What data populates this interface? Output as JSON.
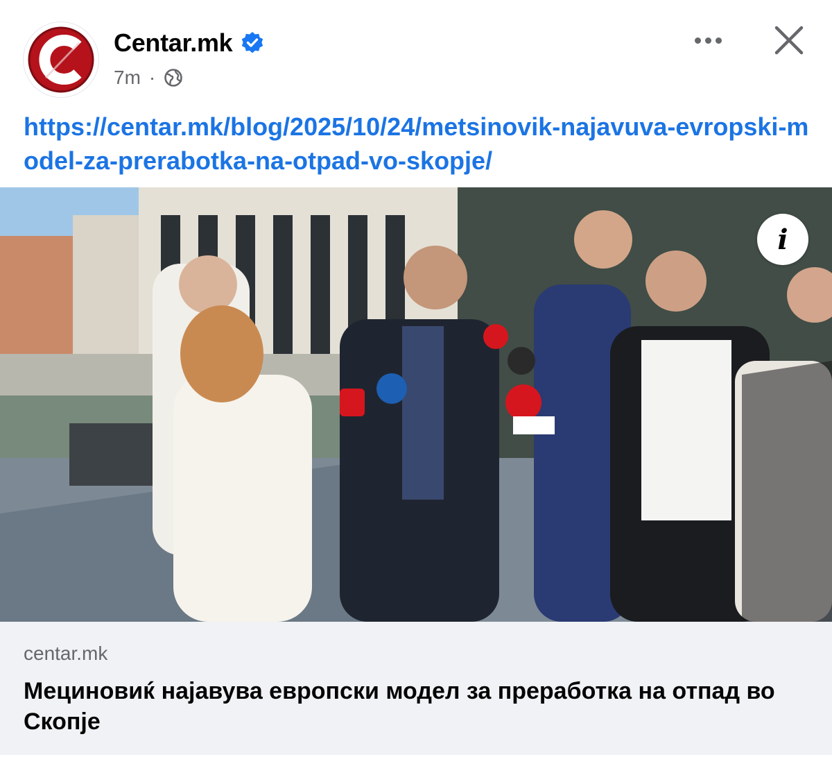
{
  "post": {
    "page_name": "Centar.mk",
    "verified": true,
    "time": "7m",
    "separator": "·",
    "audience_icon": "globe-icon",
    "link_text": "https://centar.mk/blog/2025/10/24/metsinovik-najavuva-evropski-model-za-prerabotka-na-otpad-vo-skopje/"
  },
  "link_preview": {
    "domain": "centar.mk",
    "title": "Мециновиќ најавува европски модел за преработка на отпад во Скопје",
    "info_label": "i"
  },
  "icons": {
    "avatar": "centar-logo-icon",
    "verified": "verified-badge-icon",
    "more": "more-options-icon",
    "close": "close-icon"
  },
  "colors": {
    "link": "#1b74e4",
    "verified": "#1877f2",
    "brand_red": "#b5121b",
    "card_background": "#f0f2f5",
    "secondary_text": "#65676b"
  }
}
